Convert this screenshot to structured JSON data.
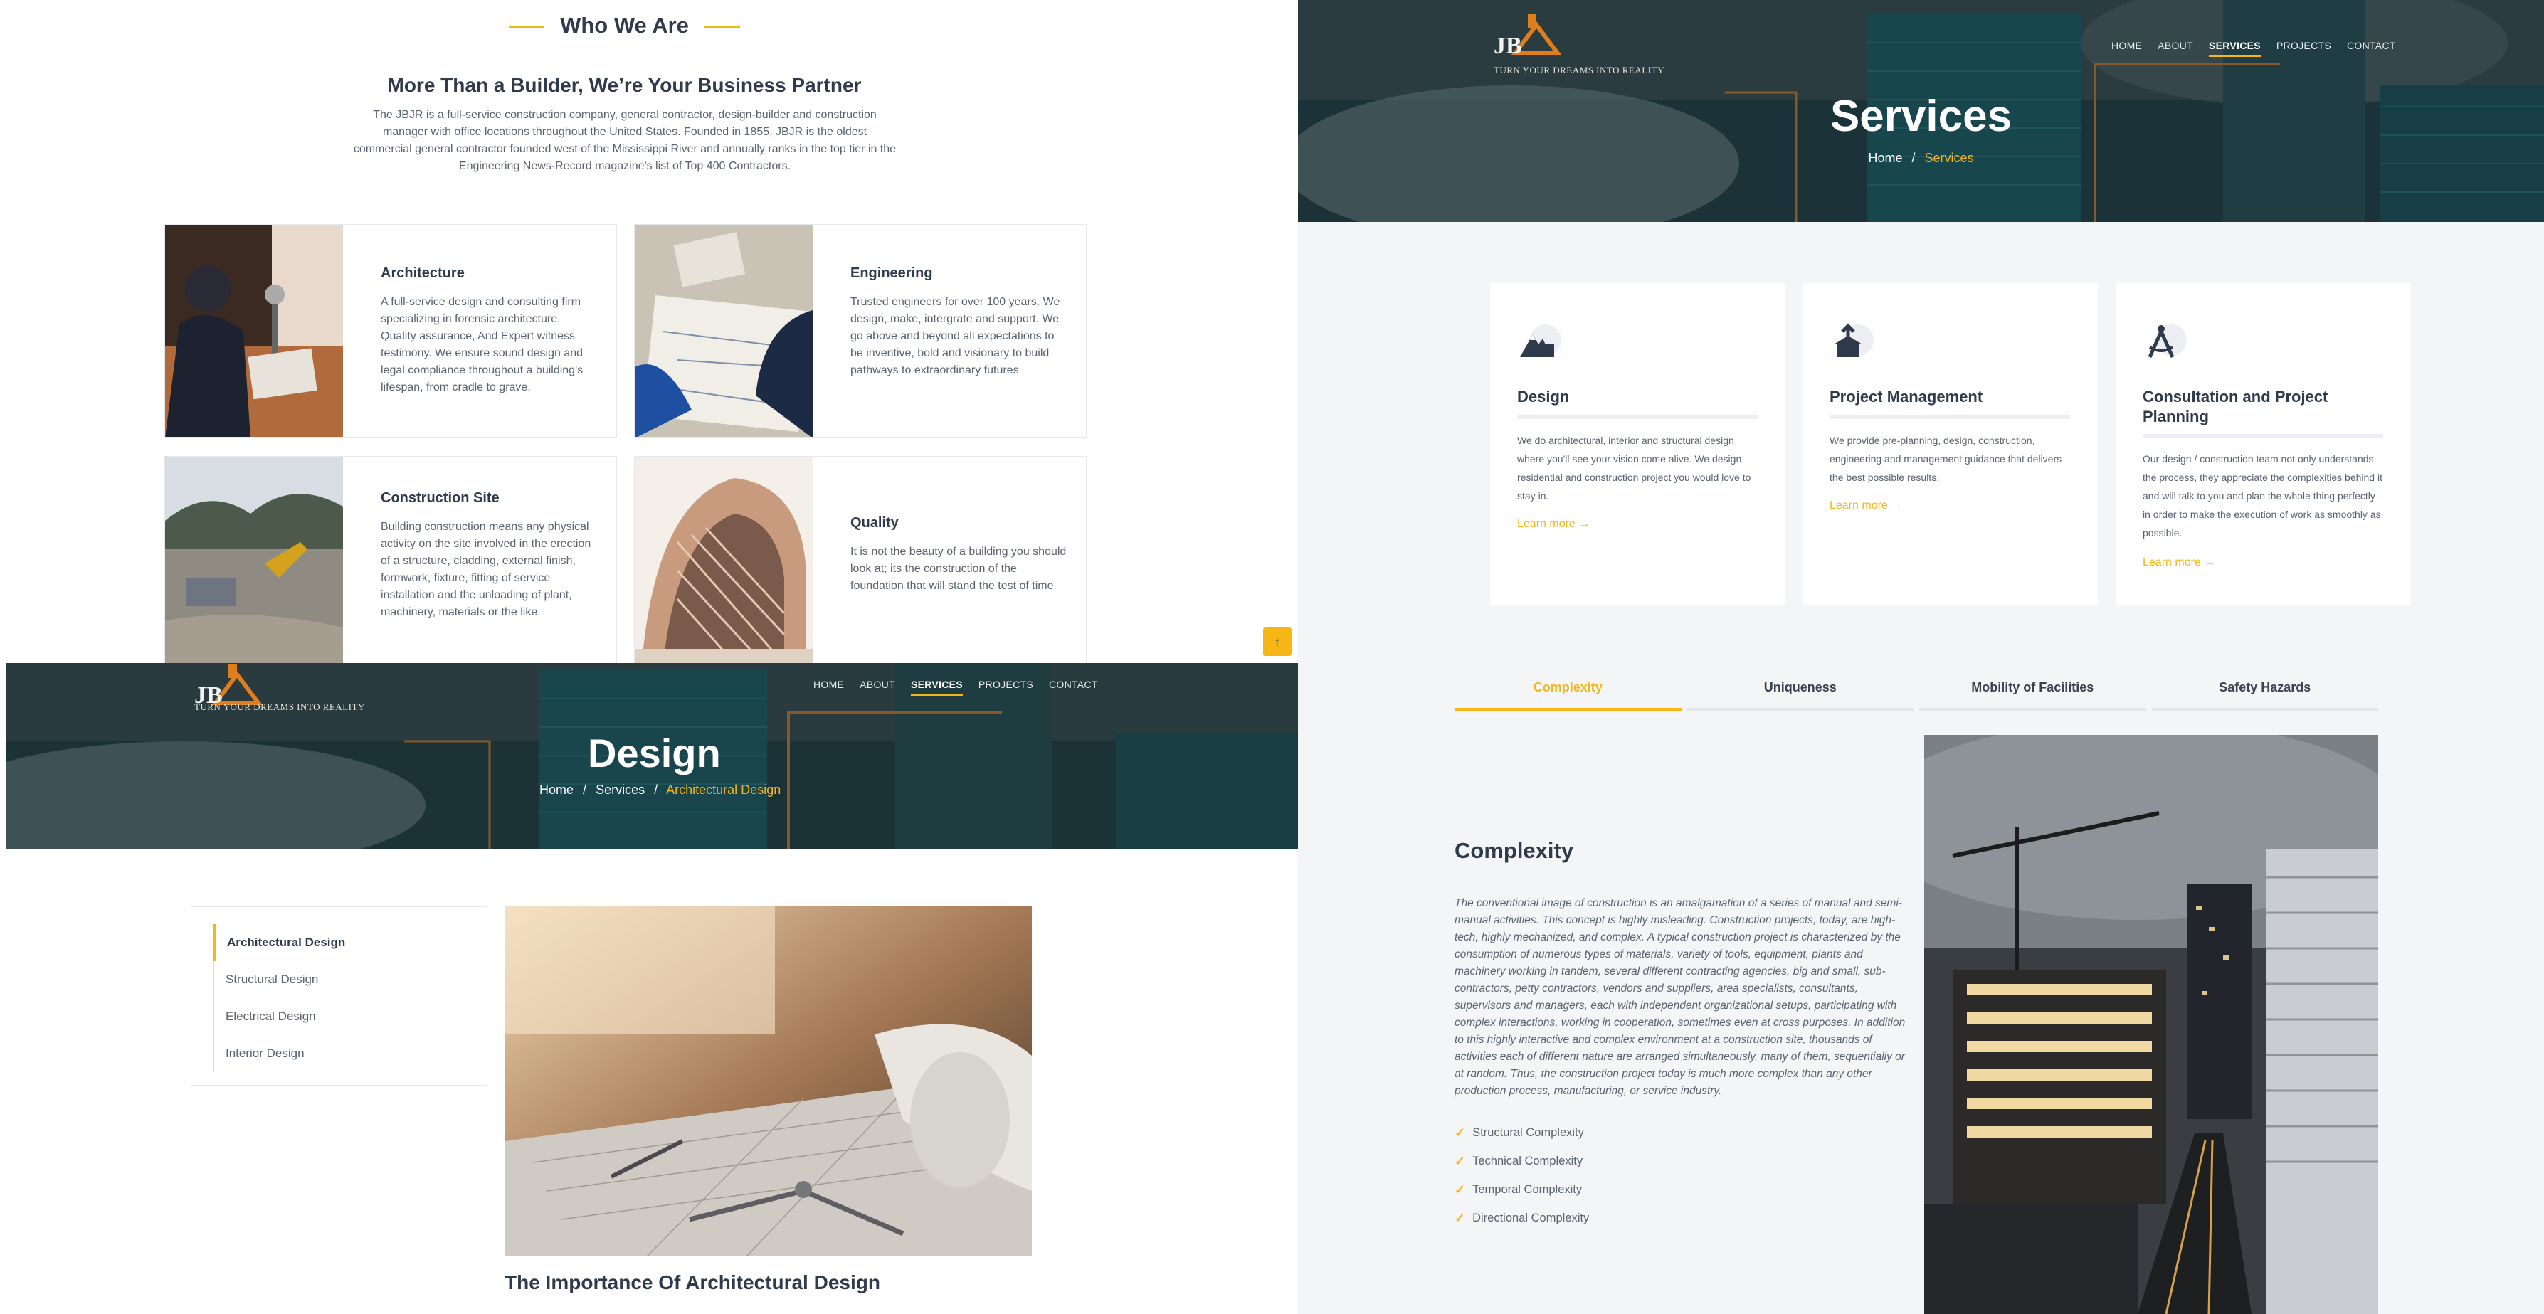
{
  "about": {
    "section_title": "Who We Are",
    "headline": "More Than a Builder, We’re Your Business Partner",
    "intro": "The JBJR is a full-service construction company, general contractor, design-builder and construction manager with office locations throughout the United States. Founded in 1855, JBJR is the oldest commercial general contractor founded west of the Mississippi River and annually ranks in the top tier in the Engineering News-Record magazine's list of Top 400 Contractors.",
    "cards": [
      {
        "title": "Architecture",
        "text": "A full-service design and consulting firm specializing in forensic architecture. Quality assurance, And Expert witness testimony. We ensure sound design and legal compliance throughout a building's lifespan, from cradle to grave."
      },
      {
        "title": "Engineering",
        "text": "Trusted engineers for over 100 years. We design, make, intergrate and support. We go above and beyond all expectations to be inventive, bold and visionary to build pathways to extraordinary futures"
      },
      {
        "title": "Construction Site",
        "text": "Building construction means any physical activity on the site involved in the erection of a structure, cladding, external finish, formwork, fixture, fitting of service installation and the unloading of plant, machinery, materials or the like."
      },
      {
        "title": "Quality",
        "text": "It is not the beauty of a building you should look at; its the construction of the foundation that will stand the test of time"
      }
    ],
    "scroll_top_icon": "arrow-up-icon"
  },
  "brand": {
    "logo_letters": "JBJR",
    "tagline": "TURN YOUR DREAMS INTO REALITY",
    "accent": "#f5b616"
  },
  "nav": {
    "items": [
      "HOME",
      "ABOUT",
      "SERVICES",
      "PROJECTS",
      "CONTACT"
    ],
    "active": "SERVICES"
  },
  "services_page": {
    "title": "Services",
    "breadcrumb": {
      "home": "Home",
      "sep": "/",
      "current": "Services"
    },
    "cards": [
      {
        "icon": "design-mountain-icon",
        "title": "Design",
        "text": "We do architectural, interior and structural design where you'll see your vision come alive. We design residential and construction project you would love to stay in.",
        "link": "Learn more"
      },
      {
        "icon": "project-management-icon",
        "title": "Project Management",
        "text": "We provide pre-planning, design, construction, engineering and management guidance that delivers the best possible results.",
        "link": "Learn more"
      },
      {
        "icon": "compass-icon",
        "title": "Consultation and Project Planning",
        "text": "Our design / construction team not only understands the process, they appreciate the complexities behind it and will talk to you and plan the whole thing perfectly in order to make the execution of work as smoothly as possible.",
        "link": "Learn more"
      }
    ],
    "tabs": [
      "Complexity",
      "Uniqueness",
      "Mobility of Facilities",
      "Safety Hazards"
    ],
    "active_tab": "Complexity",
    "complexity": {
      "title": "Complexity",
      "text": "The conventional image of construction is an amalgamation of a series of manual and semi-manual activities. This concept is highly misleading. Construction projects, today, are high-tech, highly mechanized, and complex. A typical construction project is characterized by the consumption of numerous types of materials, variety of tools, equipment, plants and machinery working in tandem, several different contracting agencies, big and small, sub-contractors, petty contractors, vendors and suppliers, area specialists, consultants, supervisors and managers, each with independent organizational setups, participating with complex interactions, working in cooperation, sometimes even at cross purposes. In addition to this highly interactive and complex environment at a construction site, thousands of activities each of different nature are arranged simultaneously, many of them, sequentially or at random. Thus, the construction project today is much more complex than any other production process, manufacturing, or service industry.",
      "checklist": [
        "Structural Complexity",
        "Technical Complexity",
        "Temporal Complexity",
        "Directional Complexity"
      ]
    }
  },
  "design_page": {
    "title": "Design",
    "breadcrumb": {
      "home": "Home",
      "sep": "/",
      "services": "Services",
      "current": "Architectural Design"
    },
    "sidebar": [
      "Architectural Design",
      "Structural Design",
      "Electrical Design",
      "Interior Design"
    ],
    "sidebar_active": "Architectural Design",
    "heading": "The Importance Of Architectural Design"
  }
}
